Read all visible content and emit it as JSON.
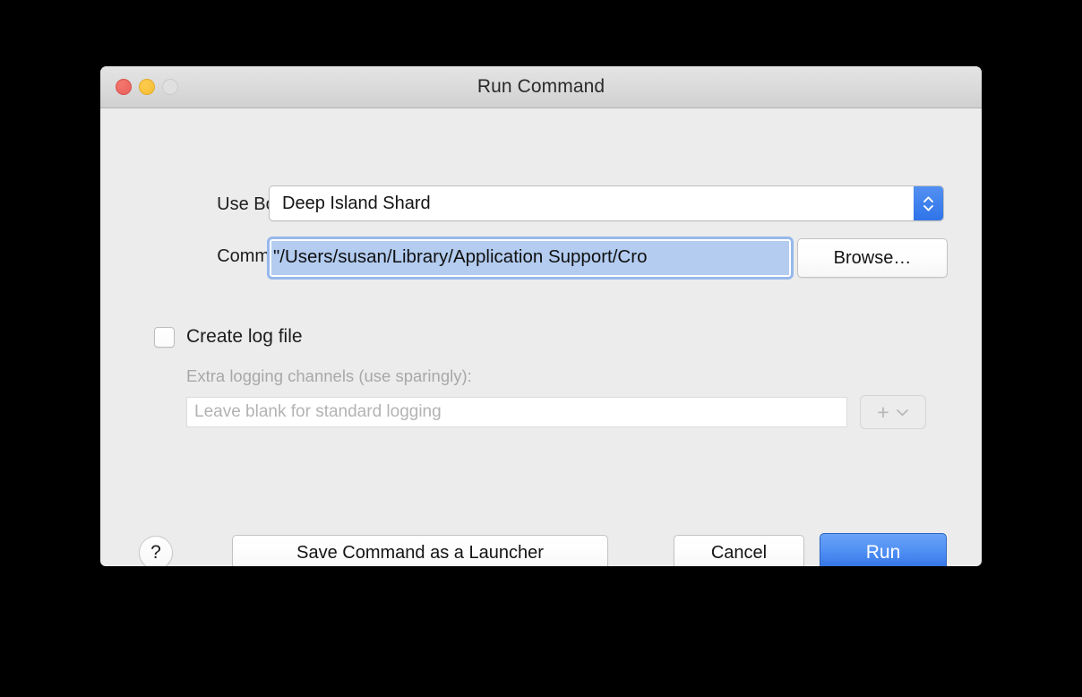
{
  "window": {
    "title": "Run Command",
    "traffic_lights": [
      {
        "name": "close",
        "state": "enabled"
      },
      {
        "name": "minimize",
        "state": "enabled"
      },
      {
        "name": "zoom",
        "state": "disabled"
      }
    ]
  },
  "form": {
    "bottle_label": "Use Bottle:",
    "bottle_value": "Deep Island Shard",
    "command_label": "Command:",
    "command_value": "\"/Users/susan/Library/Application Support/Cro",
    "browse_label": "Browse…"
  },
  "logging": {
    "create_log_label": "Create log file",
    "create_log_checked": false,
    "channels_caption": "Extra logging channels (use sparingly):",
    "channels_placeholder": "Leave blank for standard logging",
    "channels_value": "",
    "add_channel_label": "+",
    "enabled": false
  },
  "actions": {
    "help_label": "?",
    "save_launcher_label": "Save Command as a Launcher",
    "cancel_label": "Cancel",
    "run_label": "Run"
  },
  "colors": {
    "window_bg": "#ececec",
    "titlebar_top": "#e4e4e4",
    "titlebar_bottom": "#d0d0d0",
    "accent_blue": "#2f74e8",
    "selection_blue": "#b3ccf0",
    "focus_ring": "#96b8ec",
    "disabled_gray": "#b3b3b3",
    "close_red": "#e8605a",
    "minimize_yellow": "#f6bd34"
  }
}
